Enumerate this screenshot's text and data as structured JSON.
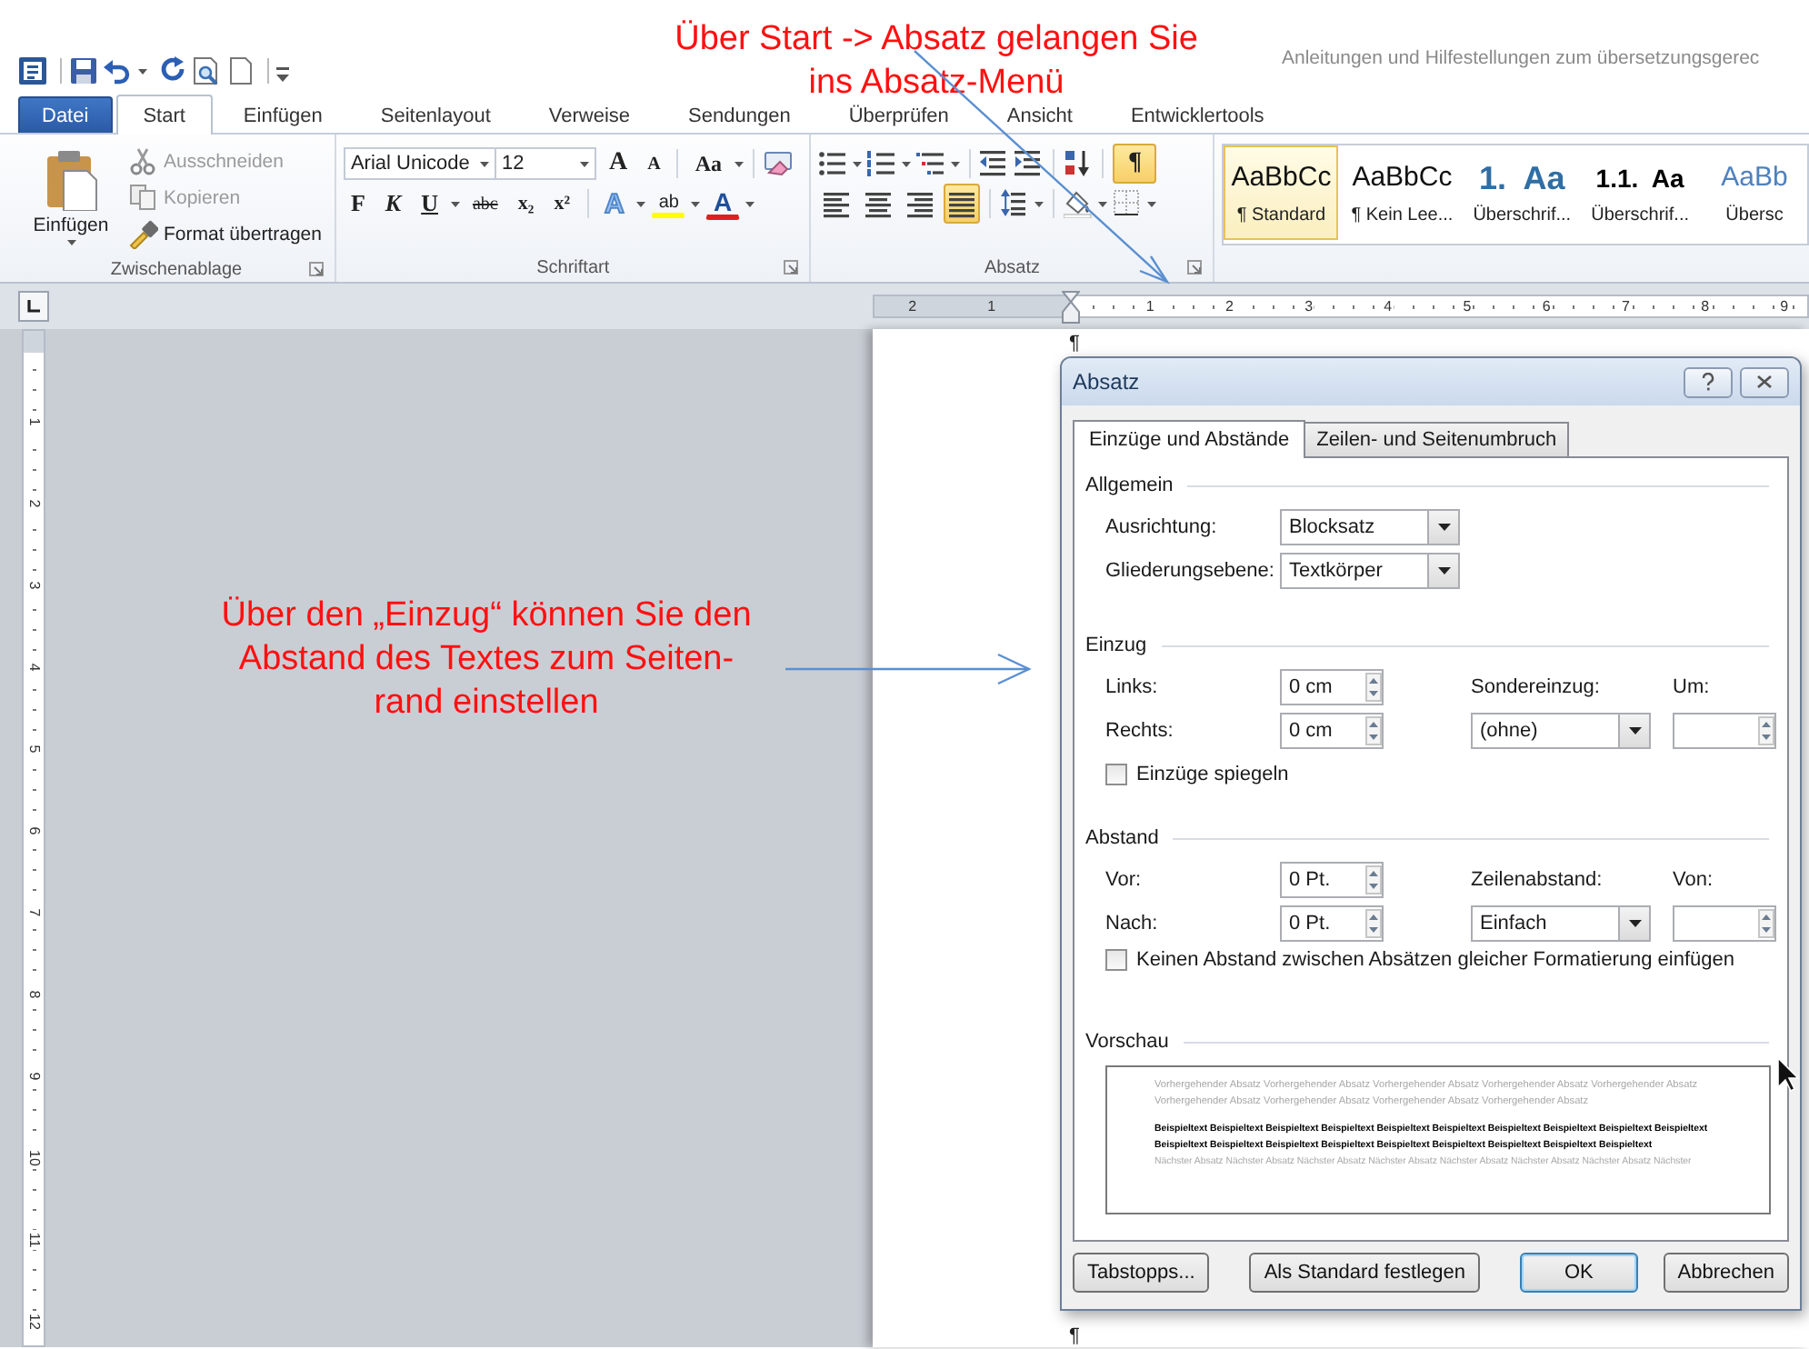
{
  "annotations": [
    {
      "lines": [
        "Über Start -> Absatz gelangen Sie",
        "ins Absatz-Menü"
      ]
    },
    {
      "lines": [
        "Über den „Einzug“ können Sie den",
        "Abstand des Textes zum Seiten-",
        "rand einstellen"
      ]
    }
  ],
  "window": {
    "title": "Anleitungen und Hilfestellungen zum übersetzungsgerec"
  },
  "tabs": [
    {
      "label": "Datei",
      "kind": "file",
      "selected": false
    },
    {
      "label": "Start",
      "kind": "tab",
      "selected": true
    },
    {
      "label": "Einfügen",
      "kind": "tab",
      "selected": false
    },
    {
      "label": "Seitenlayout",
      "kind": "tab",
      "selected": false
    },
    {
      "label": "Verweise",
      "kind": "tab",
      "selected": false
    },
    {
      "label": "Sendungen",
      "kind": "tab",
      "selected": false
    },
    {
      "label": "Überprüfen",
      "kind": "tab",
      "selected": false
    },
    {
      "label": "Ansicht",
      "kind": "tab",
      "selected": false
    },
    {
      "label": "Entwicklertools",
      "kind": "tab",
      "selected": false
    }
  ],
  "ribbon": {
    "clipboard": {
      "label": "Zwischenablage",
      "paste": "Einfügen",
      "items": [
        {
          "label": "Ausschneiden",
          "kind": "cut",
          "disabled": true
        },
        {
          "label": "Kopieren",
          "kind": "copy",
          "disabled": true
        },
        {
          "label": "Format übertragen",
          "kind": "painter",
          "disabled": false
        }
      ]
    },
    "font": {
      "label": "Schriftart",
      "font_name": "Arial Unicode",
      "font_size": "12",
      "size_buttons": [
        "A",
        "A",
        "Aa"
      ],
      "format_buttons": [
        "F",
        "K",
        "U",
        "abc",
        "x₂",
        "x²"
      ],
      "color_buttons": [
        "A",
        "ab",
        "A"
      ]
    },
    "paragraph": {
      "label": "Absatz",
      "show_marks": {
        "label": "¶",
        "on": true
      },
      "align_buttons": [
        {
          "kind": "left",
          "selected": false
        },
        {
          "kind": "center",
          "selected": false
        },
        {
          "kind": "right",
          "selected": false
        },
        {
          "kind": "justify",
          "selected": true
        }
      ]
    },
    "styles": [
      {
        "preview": "AaBbCc",
        "label": "¶ Standard",
        "kind": "normal",
        "selected": true
      },
      {
        "preview": "AaBbCc",
        "label": "¶ Kein Lee...",
        "kind": "normal",
        "selected": false
      },
      {
        "preview": "1.  Aa",
        "label": "Überschrif...",
        "kind": "heading1",
        "selected": false
      },
      {
        "preview": "1.1.  Aa",
        "label": "Überschrif...",
        "kind": "heading2",
        "selected": false
      },
      {
        "preview": "AaBb",
        "label": "Übersc",
        "kind": "title",
        "selected": false
      }
    ]
  },
  "ruler": {
    "left_numbers": [
      "2",
      "1"
    ],
    "right_numbers": [
      "1",
      "2",
      "3",
      "4",
      "5",
      "6",
      "7",
      "8",
      "9"
    ],
    "vertical_numbers": [
      "1",
      "2",
      "3",
      "4",
      "5",
      "6",
      "7",
      "8",
      "9",
      "10",
      "11",
      "12"
    ]
  },
  "document": {
    "marks": [
      "¶",
      "¶"
    ]
  },
  "dialog": {
    "title": "Absatz",
    "tabs": [
      {
        "label": "Einzüge und Abstände",
        "selected": true
      },
      {
        "label": "Zeilen- und Seitenumbruch",
        "selected": false
      }
    ],
    "general": {
      "heading": "Allgemein",
      "fields": [
        {
          "label": "Ausrichtung:",
          "value": "Blocksatz"
        },
        {
          "label": "Gliederungsebene:",
          "value": "Textkörper"
        }
      ]
    },
    "indent": {
      "heading": "Einzug",
      "left": {
        "label": "Links:",
        "value": "0 cm"
      },
      "right": {
        "label": "Rechts:",
        "value": "0 cm"
      },
      "special": {
        "label": "Sondereinzug:",
        "value": "(ohne)"
      },
      "by": {
        "label": "Um:"
      },
      "mirror": {
        "label": "Einzüge spiegeln",
        "checked": false
      }
    },
    "spacing": {
      "heading": "Abstand",
      "before": {
        "label": "Vor:",
        "value": "0 Pt."
      },
      "after": {
        "label": "Nach:",
        "value": "0 Pt."
      },
      "line": {
        "label": "Zeilenabstand:",
        "value": "Einfach"
      },
      "at": {
        "label": "Von:"
      },
      "no_space": {
        "label": "Keinen Abstand zwischen Absätzen gleicher Formatierung einfügen",
        "checked": false
      }
    },
    "preview": {
      "heading": "Vorschau",
      "previous": "Vorhergehender Absatz Vorhergehender Absatz Vorhergehender Absatz Vorhergehender Absatz Vorhergehender Absatz Vorhergehender Absatz Vorhergehender Absatz Vorhergehender Absatz Vorhergehender Absatz",
      "sample": "Beispieltext Beispieltext Beispieltext Beispieltext Beispieltext Beispieltext Beispieltext Beispieltext Beispieltext Beispieltext Beispieltext Beispieltext Beispieltext Beispieltext Beispieltext Beispieltext Beispieltext Beispieltext Beispieltext",
      "next": "Nächster Absatz Nächster Absatz Nächster Absatz Nächster Absatz Nächster Absatz Nächster Absatz Nächster Absatz Nächster"
    },
    "buttons": [
      {
        "label": "Tabstopps...",
        "default": false
      },
      {
        "label": "Als Standard festlegen",
        "default": false
      },
      {
        "label": "OK",
        "default": true
      },
      {
        "label": "Abbrechen",
        "default": false
      }
    ]
  }
}
